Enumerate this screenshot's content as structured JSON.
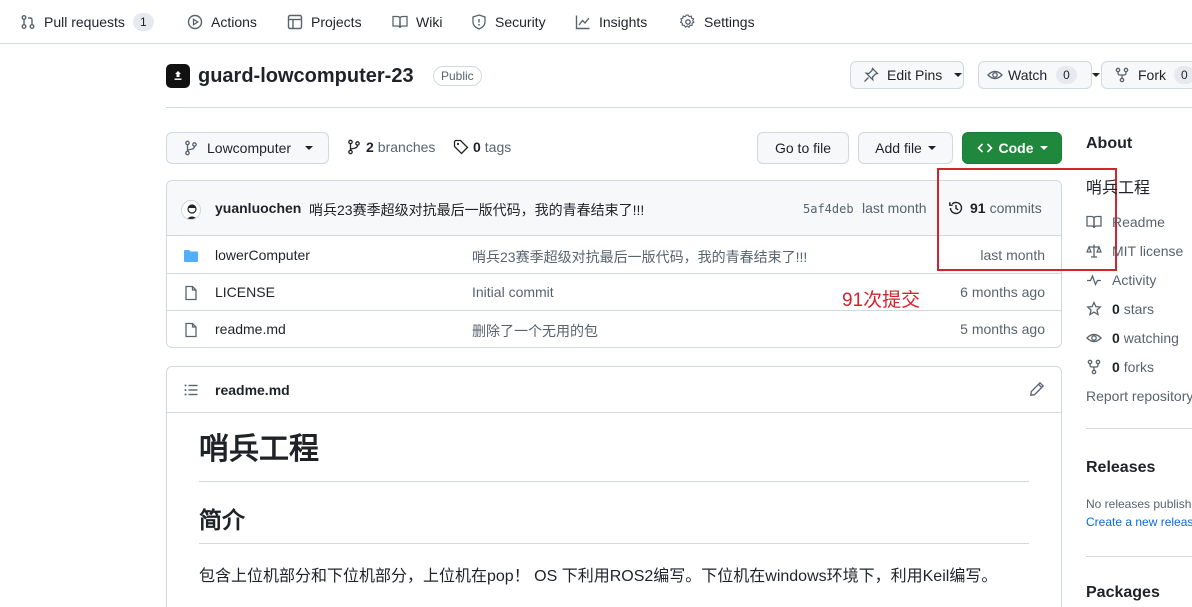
{
  "nav": {
    "items": [
      {
        "label": "Pull requests",
        "icon": "pull-request-icon",
        "count": "1"
      },
      {
        "label": "Actions",
        "icon": "play-icon"
      },
      {
        "label": "Projects",
        "icon": "table-icon"
      },
      {
        "label": "Wiki",
        "icon": "book-icon"
      },
      {
        "label": "Security",
        "icon": "shield-icon"
      },
      {
        "label": "Insights",
        "icon": "graph-icon"
      },
      {
        "label": "Settings",
        "icon": "gear-icon"
      }
    ]
  },
  "repo": {
    "name": "guard-lowcomputer-23",
    "visibility": "Public",
    "edit_pins": "Edit Pins",
    "watch": "Watch",
    "watch_count": "0",
    "fork": "Fork",
    "fork_count": "0"
  },
  "branchbar": {
    "branch": "Lowcomputer",
    "branches_count": "2",
    "branches_label": "branches",
    "tags_count": "0",
    "tags_label": "tags",
    "go_to_file": "Go to file",
    "add_file": "Add file",
    "code": "Code"
  },
  "latest_commit": {
    "author": "yuanluochen",
    "message": "哨兵23赛季超级对抗最后一版代码，我的青春结束了!!!",
    "sha": "5af4deb",
    "age": "last month",
    "commits_count": "91",
    "commits_label": "commits"
  },
  "files": [
    {
      "name": "lowerComputer",
      "type": "folder",
      "message": "哨兵23赛季超级对抗最后一版代码，我的青春结束了!!!",
      "age": "last month"
    },
    {
      "name": "LICENSE",
      "type": "file",
      "message": "Initial commit",
      "age": "6 months ago"
    },
    {
      "name": "readme.md",
      "type": "file",
      "message": "删除了一个无用的包",
      "age": "5 months ago"
    }
  ],
  "annotation": {
    "text": "91次提交",
    "color": "#d1242f"
  },
  "readme": {
    "filename": "readme.md",
    "h1": "哨兵工程",
    "h2": "简介",
    "paragraph": "包含上位机部分和下位机部分，上位机在pop！ OS 下利用ROS2编写。下位机在windows环境下，利用Keil编写。"
  },
  "about": {
    "heading": "About",
    "description": "哨兵工程",
    "readme": "Readme",
    "license": "MIT license",
    "activity": "Activity",
    "stars_count": "0",
    "stars_label": "stars",
    "watching_count": "0",
    "watching_label": "watching",
    "forks_count": "0",
    "forks_label": "forks",
    "report": "Report repository"
  },
  "releases": {
    "heading": "Releases",
    "none": "No releases published",
    "create": "Create a new release"
  },
  "packages": {
    "heading": "Packages"
  },
  "colors": {
    "accent_green": "#1f883d",
    "link_blue": "#0969da",
    "folder_blue": "#54aeff",
    "annotation_red": "#d1242f"
  }
}
